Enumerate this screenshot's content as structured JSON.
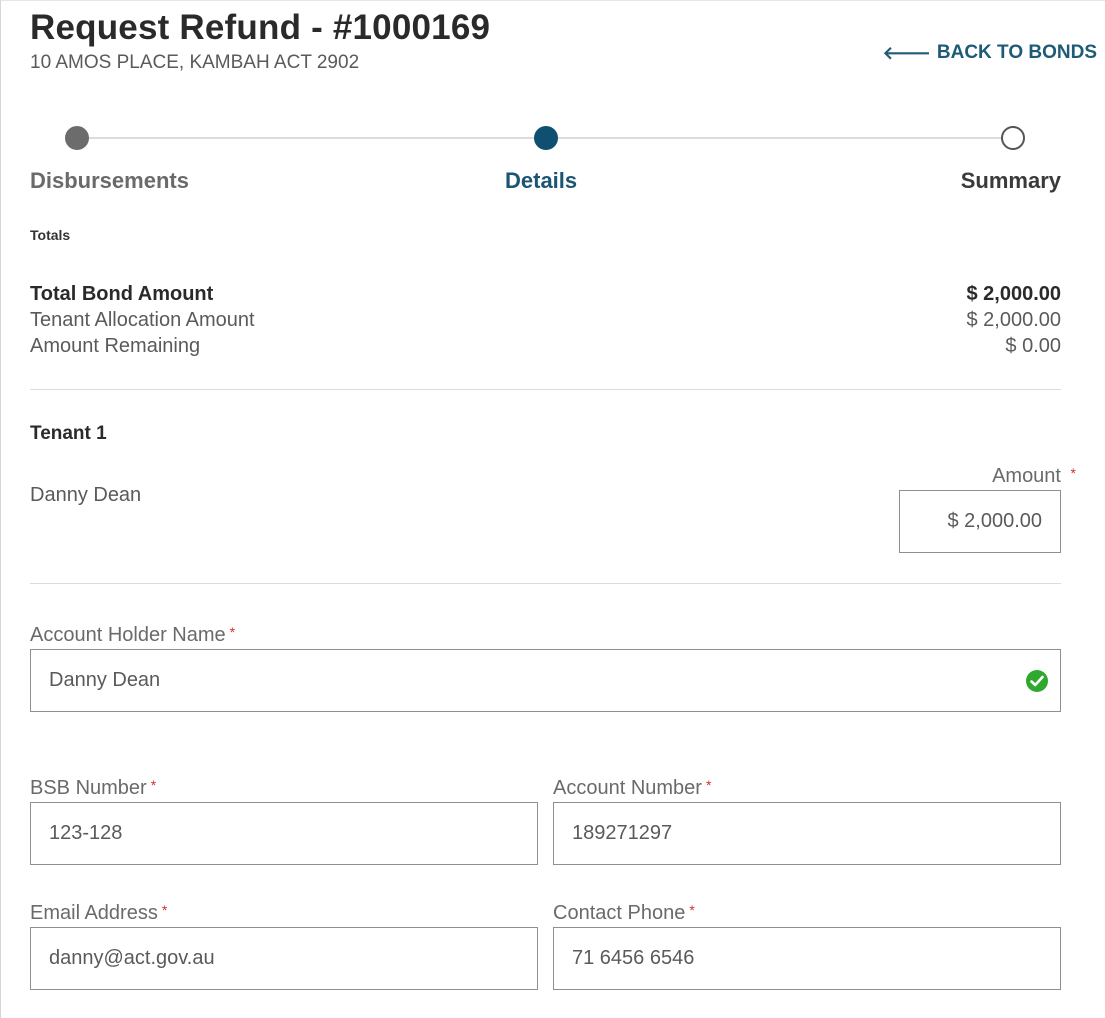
{
  "header": {
    "title": "Request Refund - #1000169",
    "address": "10 AMOS PLACE, KAMBAH ACT 2902",
    "back_label": "BACK TO BONDS"
  },
  "stepper": {
    "steps": [
      {
        "label": "Disbursements",
        "state": "done"
      },
      {
        "label": "Details",
        "state": "active"
      },
      {
        "label": "Summary",
        "state": "todo"
      }
    ]
  },
  "totals": {
    "heading": "Totals",
    "total_bond_label": "Total Bond Amount",
    "total_bond_value": "$ 2,000.00",
    "tenant_allocation_label": "Tenant Allocation Amount",
    "tenant_allocation_value": "$ 2,000.00",
    "amount_remaining_label": "Amount Remaining",
    "amount_remaining_value": "$ 0.00"
  },
  "tenant": {
    "heading": "Tenant 1",
    "name": "Danny Dean",
    "amount_label": "Amount",
    "amount_value": "$ 2,000.00"
  },
  "form": {
    "required_mark": "*",
    "account_holder_label": "Account Holder Name",
    "account_holder_value": "Danny Dean",
    "bsb_label": "BSB Number",
    "bsb_value": "123-128",
    "account_number_label": "Account Number",
    "account_number_value": "189271297",
    "email_label": "Email Address",
    "email_value": "danny@act.gov.au",
    "phone_label": "Contact Phone",
    "phone_value": "71 6456 6546"
  },
  "colors": {
    "accent": "#1b5574",
    "valid": "#2fa82f",
    "required": "#d0342c"
  }
}
